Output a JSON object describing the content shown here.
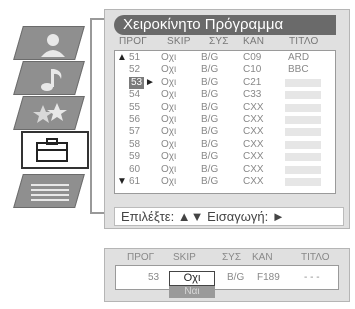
{
  "sidebar": {
    "items": [
      {
        "icon": "picture-person-icon"
      },
      {
        "icon": "sound-note-icon"
      },
      {
        "icon": "features-stars-icon"
      },
      {
        "icon": "install-toolbox-icon",
        "active": true
      },
      {
        "icon": "setup-list-icon"
      }
    ]
  },
  "main": {
    "title": "Χειροκίνητο Πρόγραμμα",
    "columns": {
      "prog": "ΠΡΟΓ",
      "skip": "SKIP",
      "sys": "ΣΥΣ",
      "chan": "ΚΑΝ",
      "title": "ΤΙΤΛΟ"
    },
    "rows": [
      {
        "marker": "▲",
        "prog": "51",
        "skip": "Οχι",
        "sys": "B/G",
        "chan": "C09",
        "title": "ARD"
      },
      {
        "marker": "",
        "prog": "52",
        "skip": "Οχι",
        "sys": "B/G",
        "chan": "C10",
        "title": "BBC"
      },
      {
        "marker": "",
        "prog": "53",
        "selected": true,
        "arrow": "►",
        "skip": "Οχι",
        "sys": "B/G",
        "chan": "C21",
        "title": ""
      },
      {
        "marker": "",
        "prog": "54",
        "skip": "Οχι",
        "sys": "B/G",
        "chan": "C33",
        "title": ""
      },
      {
        "marker": "",
        "prog": "55",
        "skip": "Οχι",
        "sys": "B/G",
        "chan": "CXX",
        "title": ""
      },
      {
        "marker": "",
        "prog": "56",
        "skip": "Οχι",
        "sys": "B/G",
        "chan": "CXX",
        "title": ""
      },
      {
        "marker": "",
        "prog": "57",
        "skip": "Οχι",
        "sys": "B/G",
        "chan": "CXX",
        "title": ""
      },
      {
        "marker": "",
        "prog": "58",
        "skip": "Οχι",
        "sys": "B/G",
        "chan": "CXX",
        "title": ""
      },
      {
        "marker": "",
        "prog": "59",
        "skip": "Οχι",
        "sys": "B/G",
        "chan": "CXX",
        "title": ""
      },
      {
        "marker": "",
        "prog": "60",
        "skip": "Οχι",
        "sys": "B/G",
        "chan": "CXX",
        "title": ""
      },
      {
        "marker": "▼",
        "prog": "61",
        "skip": "Οχι",
        "sys": "B/G",
        "chan": "CXX",
        "title": ""
      }
    ],
    "footer": "Επιλέξτε: ▲▼ Εισαγωγή: ►"
  },
  "edit": {
    "columns": {
      "prog": "ΠΡΟΓ",
      "skip": "SKIP",
      "sys": "ΣΥΣ",
      "chan": "ΚΑΝ",
      "title": "ΤΙΤΛΟ"
    },
    "prog": "53",
    "skip_value": "Οχι",
    "skip_option": "Ναι",
    "sys": "B/G",
    "chan": "F189",
    "title": "- - -"
  }
}
